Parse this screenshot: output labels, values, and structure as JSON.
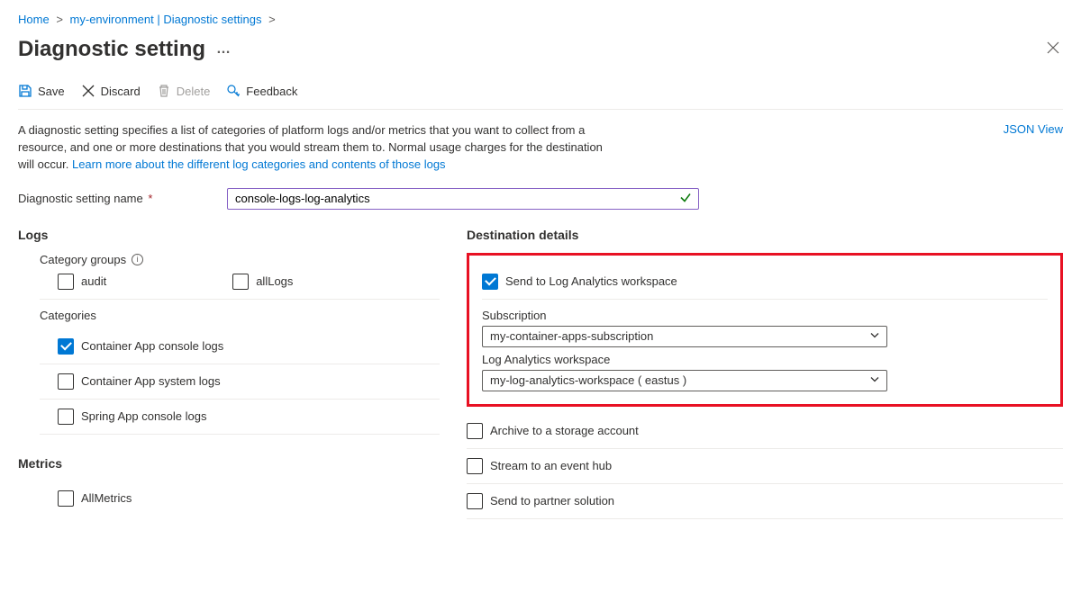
{
  "breadcrumb": {
    "home": "Home",
    "env": "my-environment | Diagnostic settings"
  },
  "page": {
    "title": "Diagnostic setting",
    "ellipsis": "…"
  },
  "toolbar": {
    "save": "Save",
    "discard": "Discard",
    "delete": "Delete",
    "feedback": "Feedback"
  },
  "description": {
    "text": "A diagnostic setting specifies a list of categories of platform logs and/or metrics that you want to collect from a resource, and one or more destinations that you would stream them to. Normal usage charges for the destination will occur. ",
    "link": "Learn more about the different log categories and contents of those logs"
  },
  "json_view": "JSON View",
  "name_field": {
    "label": "Diagnostic setting name",
    "required": "*",
    "value": "console-logs-log-analytics"
  },
  "logs": {
    "title": "Logs",
    "category_groups_label": "Category groups",
    "groups": {
      "audit": {
        "label": "audit",
        "checked": false
      },
      "allLogs": {
        "label": "allLogs",
        "checked": false
      }
    },
    "categories_label": "Categories",
    "items": [
      {
        "label": "Container App console logs",
        "checked": true
      },
      {
        "label": "Container App system logs",
        "checked": false
      },
      {
        "label": "Spring App console logs",
        "checked": false
      }
    ]
  },
  "metrics": {
    "title": "Metrics",
    "item": {
      "label": "AllMetrics",
      "checked": false
    }
  },
  "destinations": {
    "title": "Destination details",
    "log_analytics": {
      "label": "Send to Log Analytics workspace",
      "checked": true,
      "subscription_label": "Subscription",
      "subscription_value": "my-container-apps-subscription",
      "workspace_label": "Log Analytics workspace",
      "workspace_value": "my-log-analytics-workspace ( eastus )"
    },
    "storage": {
      "label": "Archive to a storage account",
      "checked": false
    },
    "eventhub": {
      "label": "Stream to an event hub",
      "checked": false
    },
    "partner": {
      "label": "Send to partner solution",
      "checked": false
    }
  }
}
